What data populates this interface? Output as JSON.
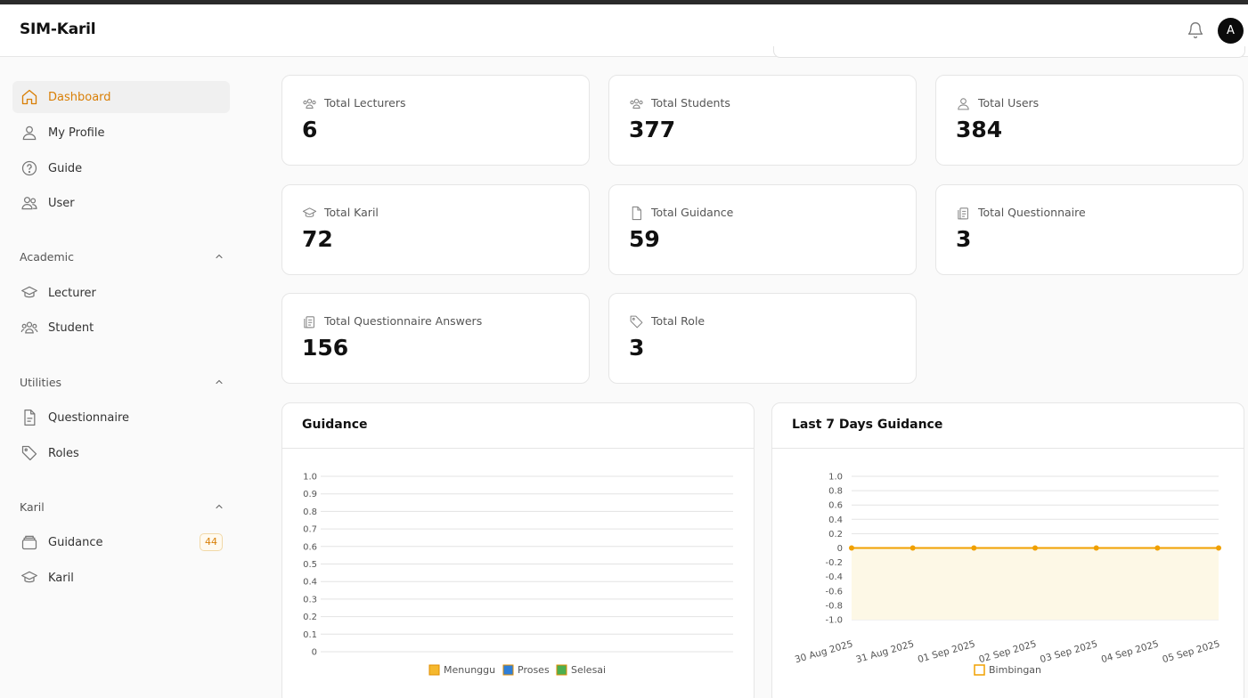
{
  "app": {
    "title": "SIM-Karil",
    "avatar_letter": "A"
  },
  "sidebar": {
    "main_items": [
      {
        "label": "Dashboard",
        "icon": "home-icon",
        "active": true
      },
      {
        "label": "My Profile",
        "icon": "user-icon"
      },
      {
        "label": "Guide",
        "icon": "help-circle-icon"
      },
      {
        "label": "User",
        "icon": "users-icon"
      }
    ],
    "sections": [
      {
        "label": "Academic",
        "items": [
          {
            "label": "Lecturer",
            "icon": "graduation-cap-icon"
          },
          {
            "label": "Student",
            "icon": "group-icon"
          }
        ]
      },
      {
        "label": "Utilities",
        "items": [
          {
            "label": "Questionnaire",
            "icon": "file-text-icon"
          },
          {
            "label": "Roles",
            "icon": "tag-icon"
          }
        ]
      },
      {
        "label": "Karil",
        "items": [
          {
            "label": "Guidance",
            "icon": "layers-icon",
            "badge": "44"
          },
          {
            "label": "Karil",
            "icon": "graduation-cap-icon"
          }
        ]
      }
    ]
  },
  "stats": [
    {
      "label": "Total Lecturers",
      "value": "6",
      "icon": "users-icon"
    },
    {
      "label": "Total Students",
      "value": "377",
      "icon": "users-icon"
    },
    {
      "label": "Total Users",
      "value": "384",
      "icon": "user-icon"
    },
    {
      "label": "Total Karil",
      "value": "72",
      "icon": "graduation-cap-icon"
    },
    {
      "label": "Total Guidance",
      "value": "59",
      "icon": "file-icon"
    },
    {
      "label": "Total Questionnaire",
      "value": "3",
      "icon": "clipboard-icon"
    },
    {
      "label": "Total Questionnaire Answers",
      "value": "156",
      "icon": "clipboard-icon"
    },
    {
      "label": "Total Role",
      "value": "3",
      "icon": "tag-icon"
    }
  ],
  "colors": {
    "accent": "#d97f06",
    "menunggu": "#f5b82e",
    "proses": "#2f7fd8",
    "selesai": "#4caf50",
    "line": "#f0a000",
    "area": "#fdf8e6"
  },
  "chart_data": [
    {
      "type": "bar",
      "title": "Guidance",
      "categories": [],
      "series": [
        {
          "name": "Menunggu",
          "values": []
        },
        {
          "name": "Proses",
          "values": []
        },
        {
          "name": "Selesai",
          "values": []
        }
      ],
      "ylim": [
        0,
        1.0
      ],
      "yticks": [
        "1.0",
        "0.9",
        "0.8",
        "0.7",
        "0.6",
        "0.5",
        "0.4",
        "0.3",
        "0.2",
        "0.1",
        "0"
      ],
      "grid": true,
      "legend": "bottom"
    },
    {
      "type": "area",
      "title": "Last 7 Days Guidance",
      "x": [
        "30 Aug 2025",
        "31 Aug 2025",
        "01 Sep 2025",
        "02 Sep 2025",
        "03 Sep 2025",
        "04 Sep 2025",
        "05 Sep 2025"
      ],
      "series": [
        {
          "name": "Bimbingan",
          "values": [
            0,
            0,
            0,
            0,
            0,
            0,
            0
          ]
        }
      ],
      "ylim": [
        -1.0,
        1.0
      ],
      "yticks": [
        "1.0",
        "0.8",
        "0.6",
        "0.4",
        "0.2",
        "0",
        "-0.2",
        "-0.4",
        "-0.6",
        "-0.8",
        "-1.0"
      ],
      "grid": true,
      "legend": "bottom"
    }
  ]
}
